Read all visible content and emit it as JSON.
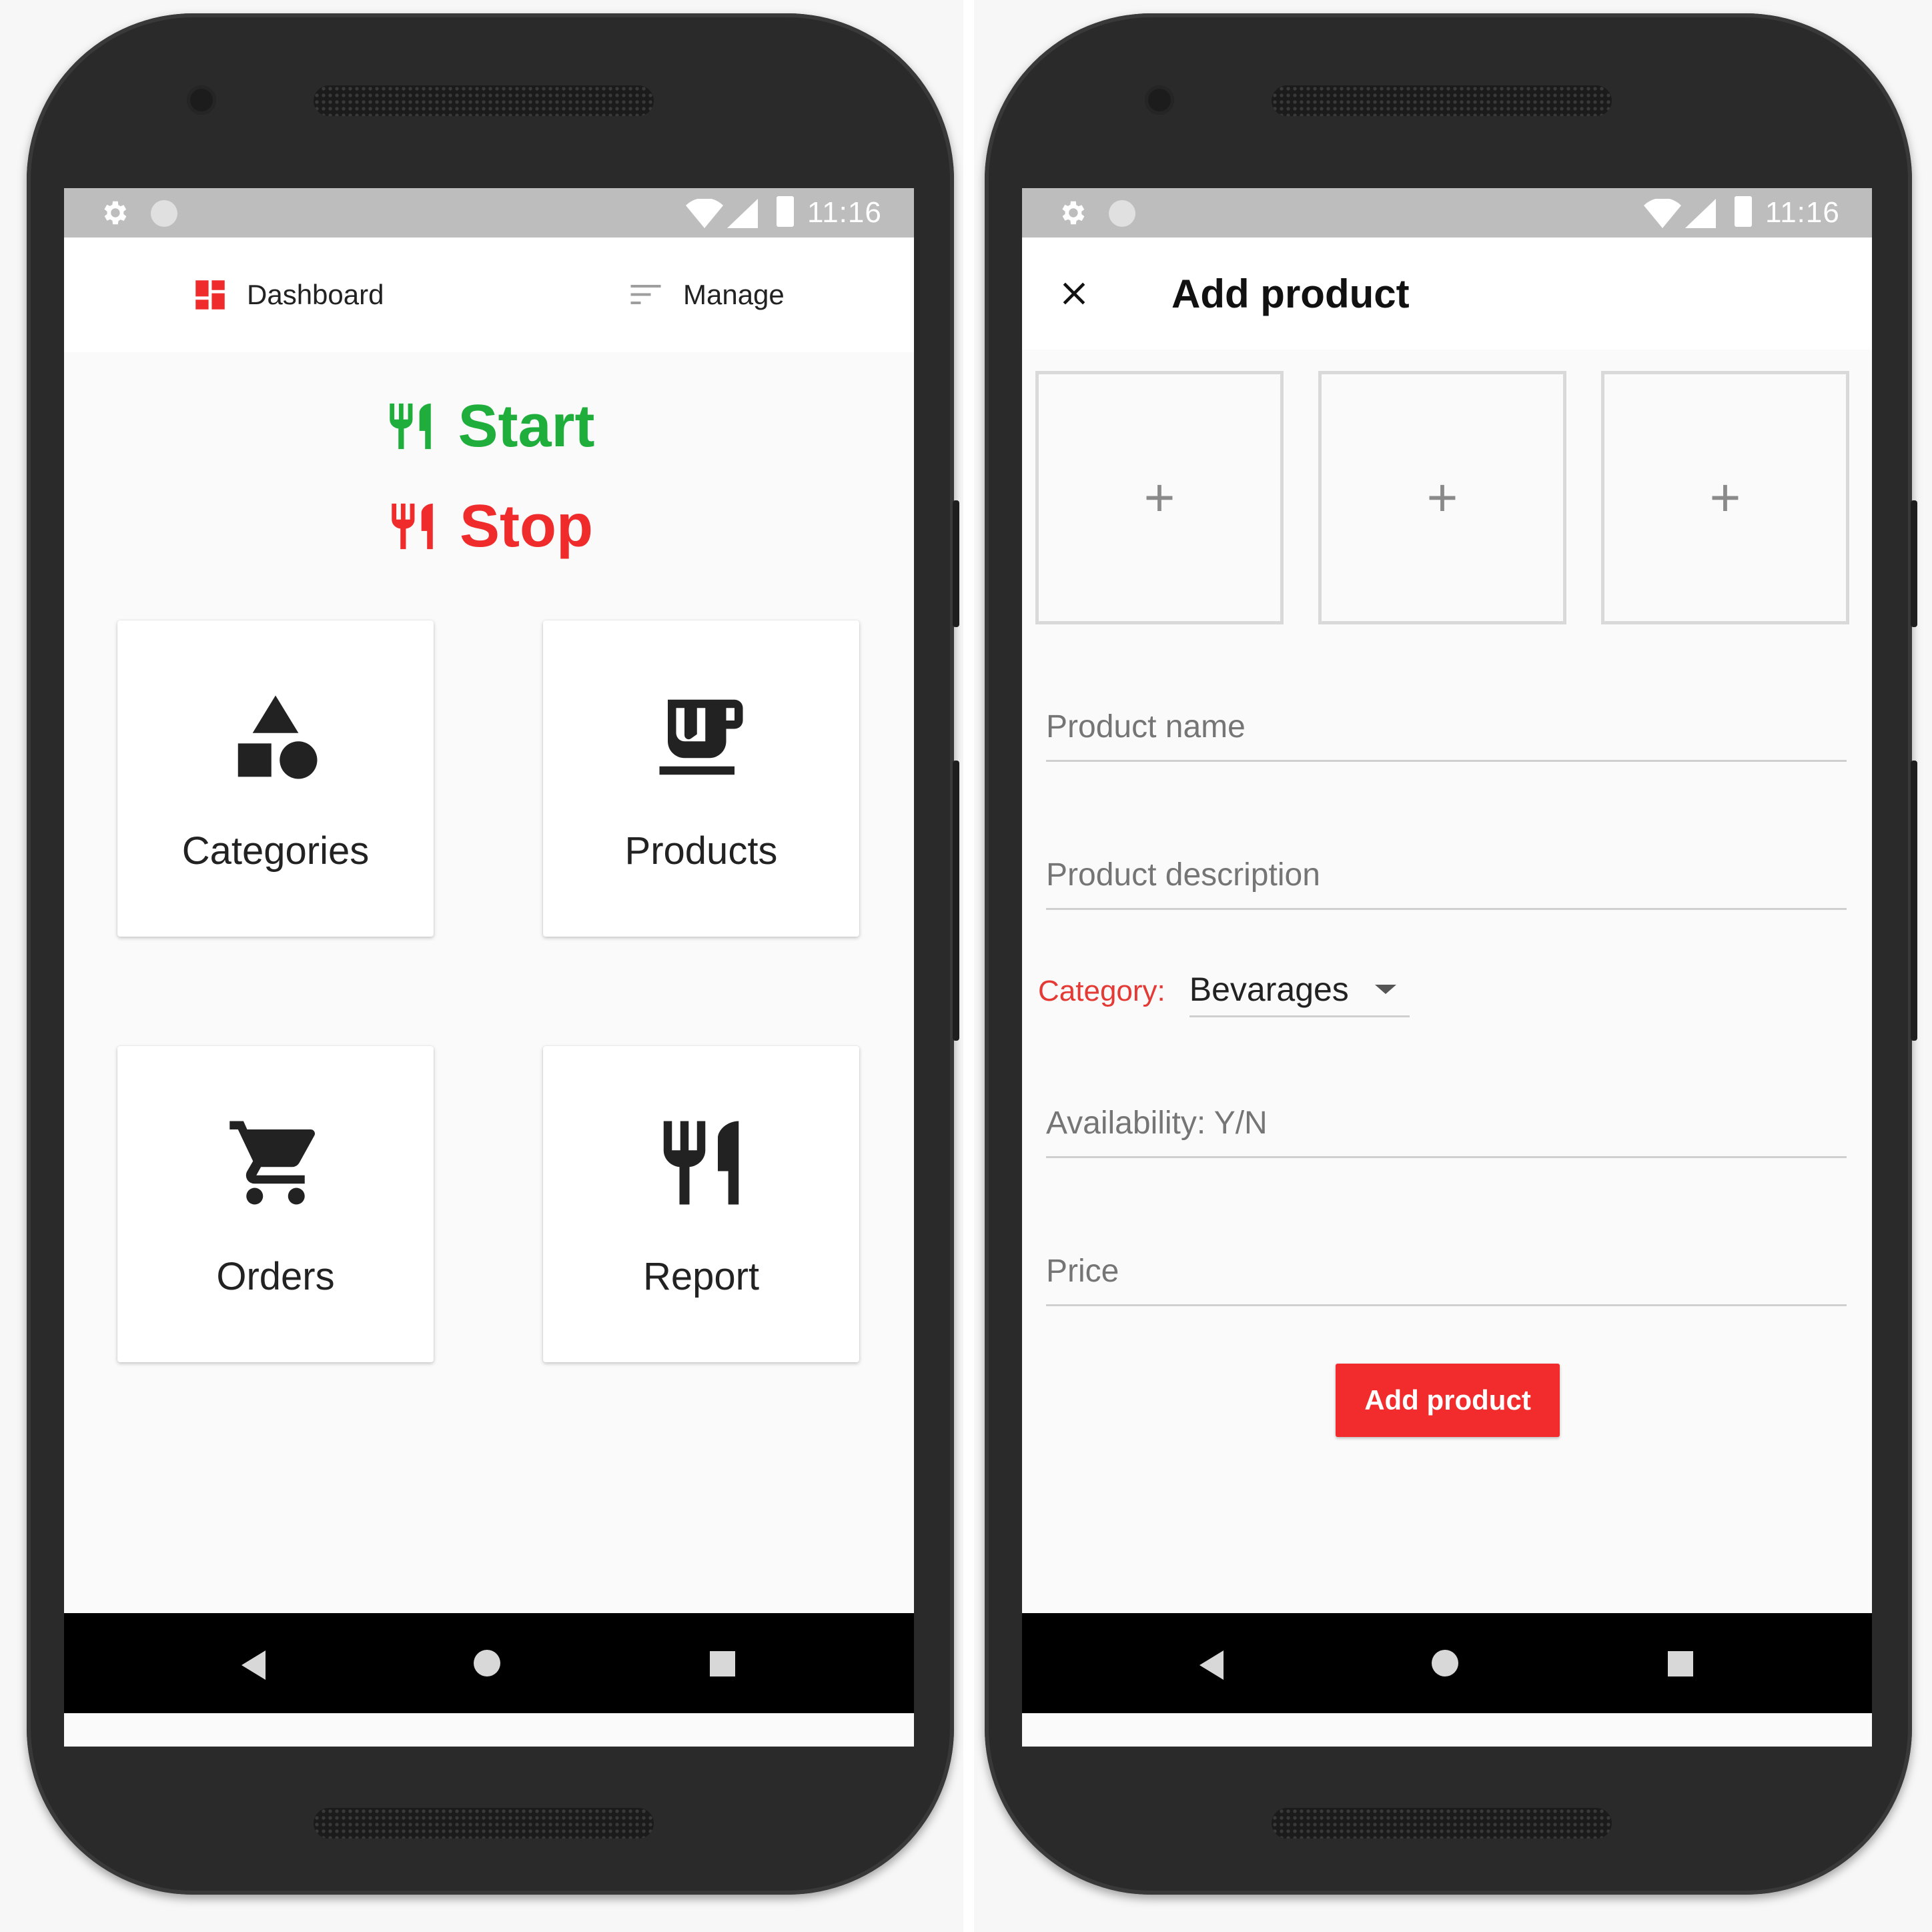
{
  "status_bar": {
    "time": "11:16"
  },
  "dashboard": {
    "tabs": [
      {
        "label": "Dashboard",
        "icon": "dashboard-icon"
      },
      {
        "label": "Manage",
        "icon": "sort-icon"
      }
    ],
    "start_label": "Start",
    "stop_label": "Stop",
    "cards": [
      {
        "label": "Categories",
        "icon": "category-shapes-icon"
      },
      {
        "label": "Products",
        "icon": "coffee-cup-icon"
      },
      {
        "label": "Orders",
        "icon": "shopping-cart-icon"
      },
      {
        "label": "Report",
        "icon": "restaurant-icon"
      }
    ],
    "colors": {
      "start": "#1fae3c",
      "stop": "#ef2b2b",
      "accent": "#ef2b2b"
    }
  },
  "add_product": {
    "title": "Add product",
    "image_slot_symbol": "+",
    "fields": {
      "name_placeholder": "Product name",
      "description_placeholder": "Product description",
      "availability_placeholder": "Availability: Y/N",
      "price_placeholder": "Price"
    },
    "category": {
      "label": "Category:",
      "selected": "Bevarages"
    },
    "submit_label": "Add product",
    "colors": {
      "button": "#f22c2c",
      "category_label": "#e53935"
    }
  }
}
